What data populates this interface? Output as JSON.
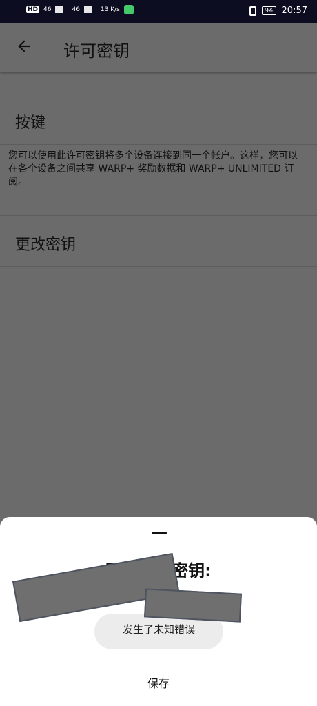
{
  "status_bar": {
    "left_badges": [
      "HD",
      "46",
      "46"
    ],
    "speed": "13 K/s",
    "battery": "94",
    "time": "20:57"
  },
  "app_bar": {
    "back_icon": "arrow-left-icon",
    "title": "许可密钥"
  },
  "sections": {
    "key_label": "按键",
    "description": "您可以使用此许可密钥将多个设备连接到同一个帐户。这样，您可以在各个设备之间共享 WARP+ 奖励数据和 WARP+ UNLIMITED 订阅。",
    "change_key_label": "更改密钥"
  },
  "bottom_sheet": {
    "title": "更新许可密钥:",
    "toast": "发生了未知错误",
    "save_label": "保存"
  }
}
